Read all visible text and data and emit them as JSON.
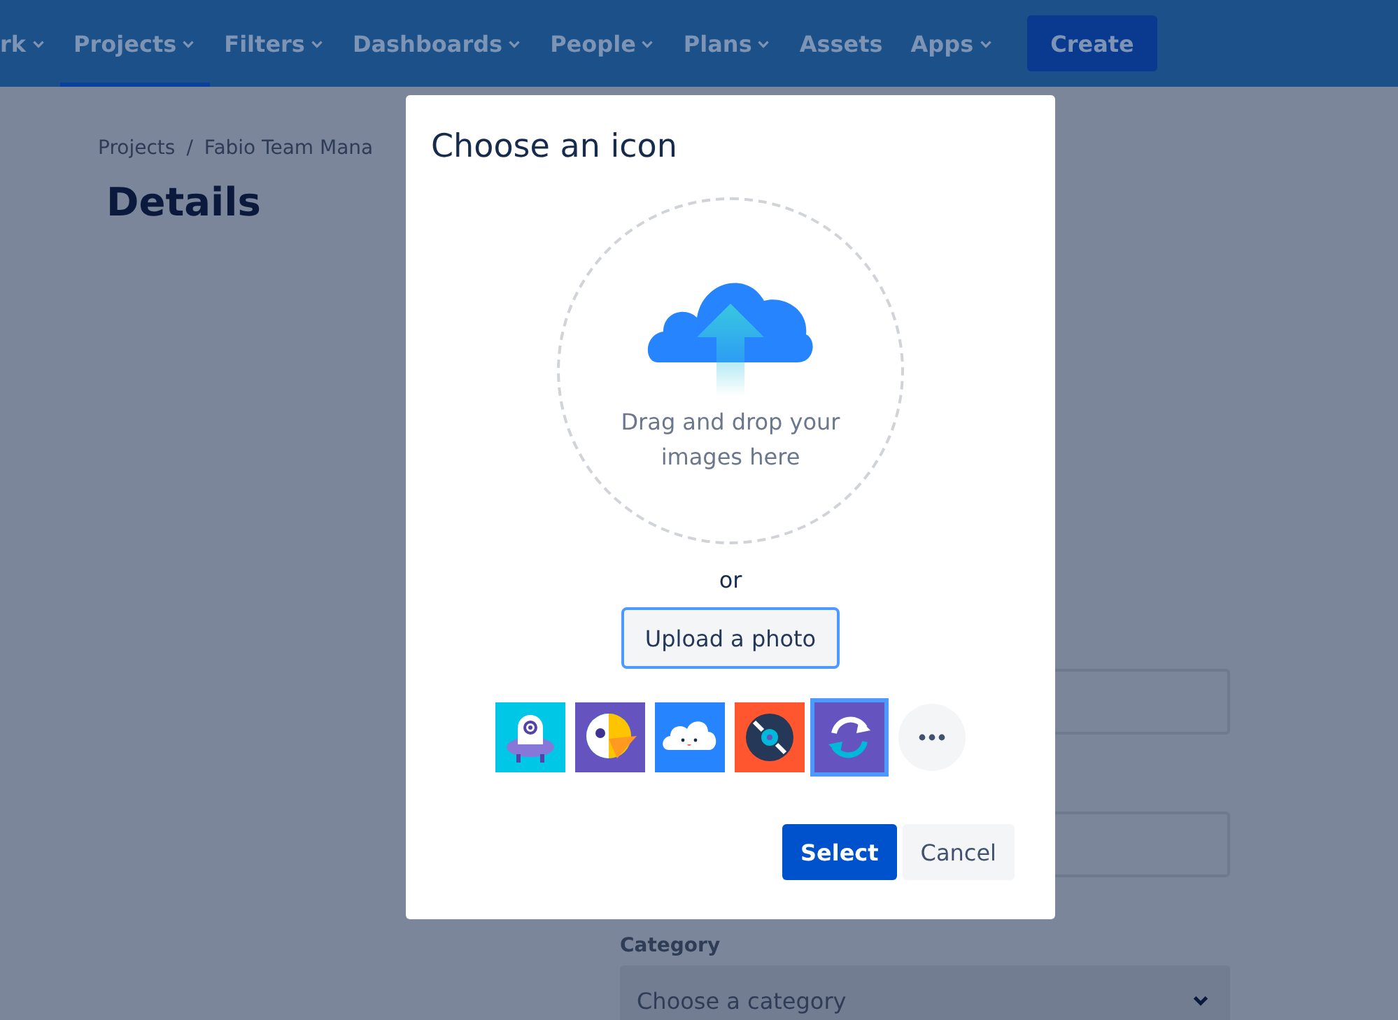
{
  "nav": {
    "items": [
      {
        "label": "rk",
        "has_menu": true,
        "selected": false
      },
      {
        "label": "Projects",
        "has_menu": true,
        "selected": true
      },
      {
        "label": "Filters",
        "has_menu": true,
        "selected": false
      },
      {
        "label": "Dashboards",
        "has_menu": true,
        "selected": false
      },
      {
        "label": "People",
        "has_menu": true,
        "selected": false
      },
      {
        "label": "Plans",
        "has_menu": true,
        "selected": false
      },
      {
        "label": "Assets",
        "has_menu": false,
        "selected": false
      },
      {
        "label": "Apps",
        "has_menu": true,
        "selected": false
      }
    ],
    "create_button": "Create"
  },
  "breadcrumb": [
    "Projects",
    "Fabio Team Mana"
  ],
  "breadcrumb_separator": "/",
  "heading": "Details",
  "form": {
    "category_label": "Category",
    "category_placeholder": "Choose a category"
  },
  "dialog": {
    "title": "Choose an icon",
    "dropzone_text": "Drag and drop your images here",
    "or": "or",
    "upload_button": "Upload a photo",
    "avatars": [
      {
        "kind": "ufo",
        "selected": false
      },
      {
        "kind": "parrot",
        "selected": false
      },
      {
        "kind": "cloud",
        "selected": false
      },
      {
        "kind": "record",
        "selected": false
      },
      {
        "kind": "refresh",
        "selected": true
      }
    ],
    "select_button": "Select",
    "cancel_button": "Cancel"
  }
}
